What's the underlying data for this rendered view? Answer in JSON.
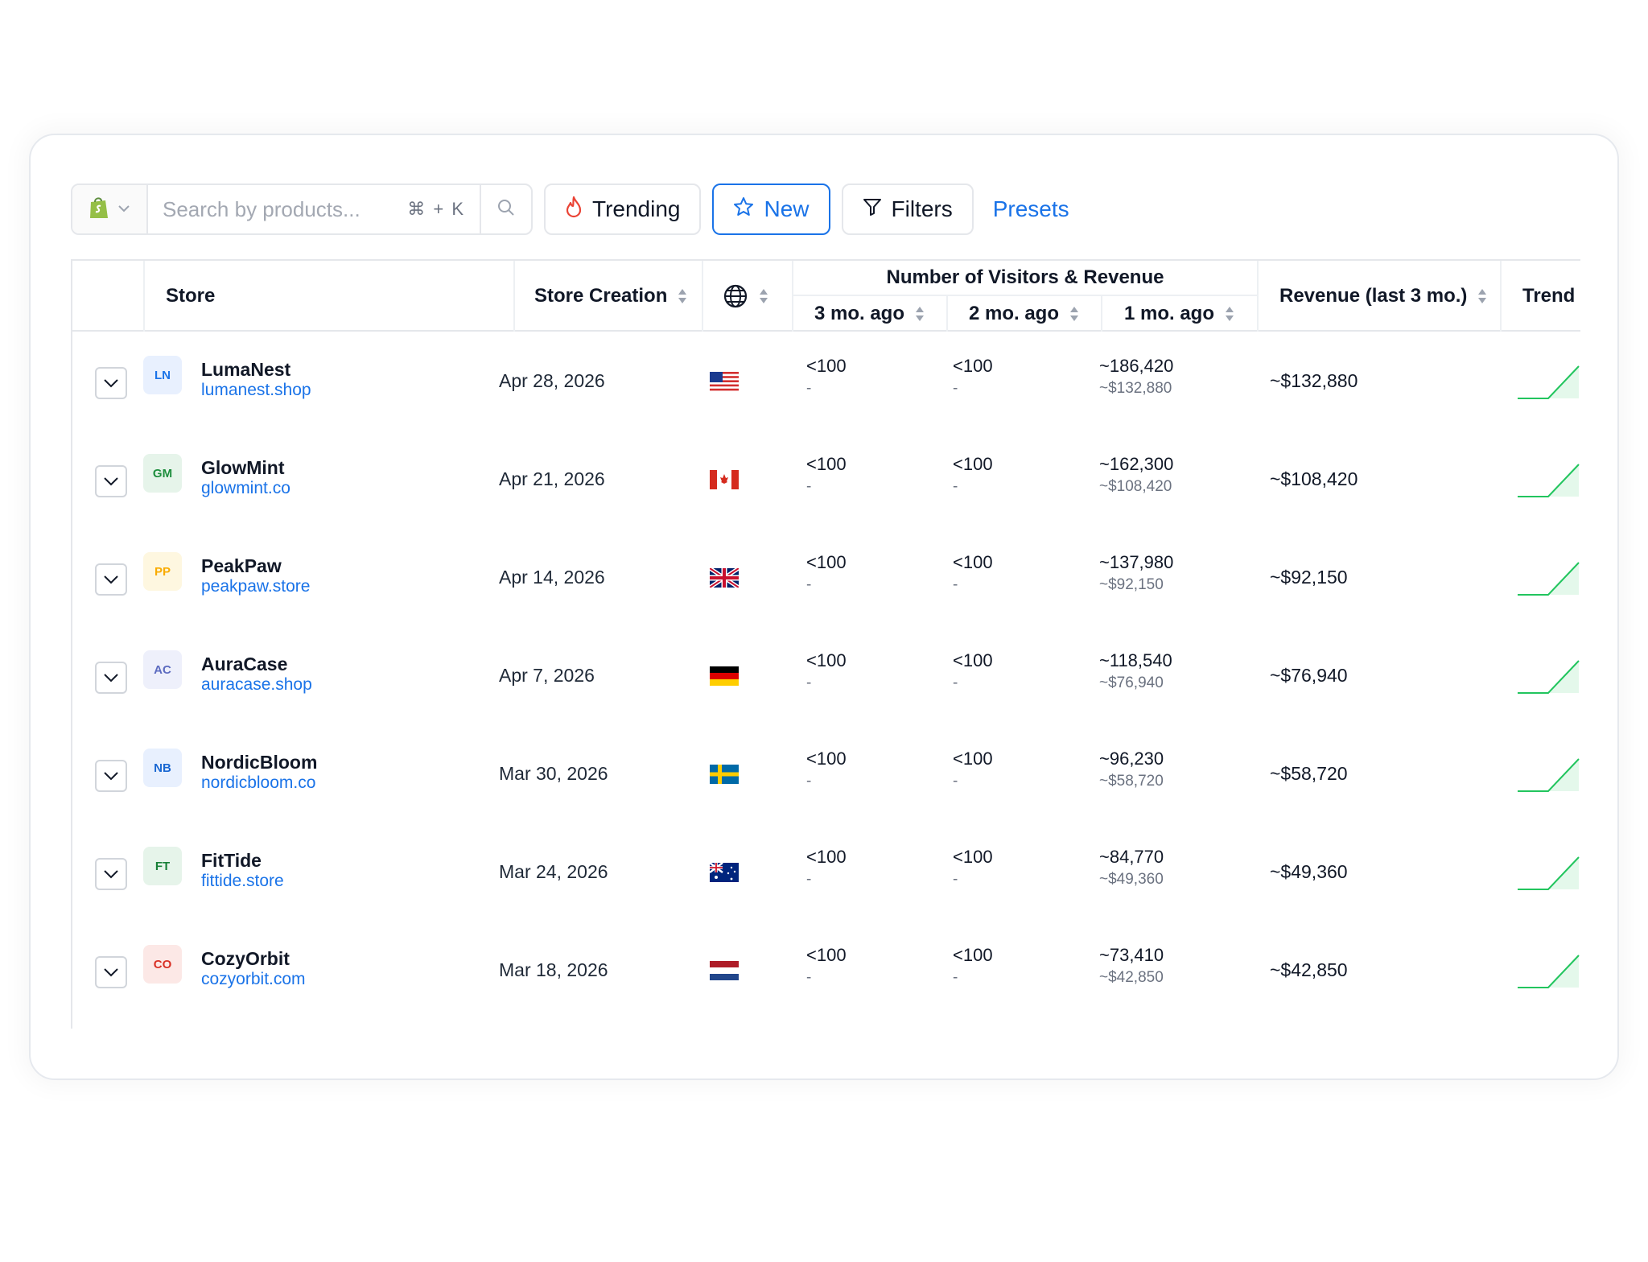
{
  "toolbar": {
    "platform_icon": "shopify-bag-icon",
    "search_placeholder": "Search by products...",
    "shortcut": "⌘ + K",
    "trending_label": "Trending",
    "new_label": "New",
    "filters_label": "Filters",
    "presets_label": "Presets",
    "accent_color": "#1a73e8"
  },
  "table": {
    "headers": {
      "store": "Store",
      "store_creation": "Store Creation",
      "country_icon": "globe-icon",
      "visitors_group": "Number of Visitors & Revenue",
      "m3": "3 mo. ago",
      "m2": "2 mo. ago",
      "m1": "1 mo. ago",
      "revenue": "Revenue (last 3 mo.)",
      "trend": "Trend"
    },
    "rows": [
      {
        "initials": "LN",
        "name": "LumaNest",
        "domain": "lumanest.shop",
        "created": "Apr 28, 2026",
        "country": "us",
        "m3_visitors": "<100",
        "m3_revenue": "-",
        "m2_visitors": "<100",
        "m2_revenue": "-",
        "m1_visitors": "~186,420",
        "m1_revenue": "~$132,880",
        "revenue": "~$132,880",
        "avatar_bg": "#e8f0fe",
        "avatar_fg": "#1a73e8"
      },
      {
        "initials": "GM",
        "name": "GlowMint",
        "domain": "glowmint.co",
        "created": "Apr 21, 2026",
        "country": "ca",
        "m3_visitors": "<100",
        "m3_revenue": "-",
        "m2_visitors": "<100",
        "m2_revenue": "-",
        "m1_visitors": "~162,300",
        "m1_revenue": "~$108,420",
        "revenue": "~$108,420",
        "avatar_bg": "#e6f4ea",
        "avatar_fg": "#1e8e3e"
      },
      {
        "initials": "PP",
        "name": "PeakPaw",
        "domain": "peakpaw.store",
        "created": "Apr 14, 2026",
        "country": "gb",
        "m3_visitors": "<100",
        "m3_revenue": "-",
        "m2_visitors": "<100",
        "m2_revenue": "-",
        "m1_visitors": "~137,980",
        "m1_revenue": "~$92,150",
        "revenue": "~$92,150",
        "avatar_bg": "#fef7e0",
        "avatar_fg": "#f9ab00"
      },
      {
        "initials": "AC",
        "name": "AuraCase",
        "domain": "auracase.shop",
        "created": "Apr 7, 2026",
        "country": "de",
        "m3_visitors": "<100",
        "m3_revenue": "-",
        "m2_visitors": "<100",
        "m2_revenue": "-",
        "m1_visitors": "~118,540",
        "m1_revenue": "~$76,940",
        "revenue": "~$76,940",
        "avatar_bg": "#eef0fb",
        "avatar_fg": "#5c6bc0"
      },
      {
        "initials": "NB",
        "name": "NordicBloom",
        "domain": "nordicbloom.co",
        "created": "Mar 30, 2026",
        "country": "se",
        "m3_visitors": "<100",
        "m3_revenue": "-",
        "m2_visitors": "<100",
        "m2_revenue": "-",
        "m1_visitors": "~96,230",
        "m1_revenue": "~$58,720",
        "revenue": "~$58,720",
        "avatar_bg": "#e8f0fe",
        "avatar_fg": "#1967d2"
      },
      {
        "initials": "FT",
        "name": "FitTide",
        "domain": "fittide.store",
        "created": "Mar 24, 2026",
        "country": "au",
        "m3_visitors": "<100",
        "m3_revenue": "-",
        "m2_visitors": "<100",
        "m2_revenue": "-",
        "m1_visitors": "~84,770",
        "m1_revenue": "~$49,360",
        "revenue": "~$49,360",
        "avatar_bg": "#e6f4ea",
        "avatar_fg": "#188038"
      },
      {
        "initials": "CO",
        "name": "CozyOrbit",
        "domain": "cozyorbit.com",
        "created": "Mar 18, 2026",
        "country": "nl",
        "m3_visitors": "<100",
        "m3_revenue": "-",
        "m2_visitors": "<100",
        "m2_revenue": "-",
        "m1_visitors": "~73,410",
        "m1_revenue": "~$42,850",
        "revenue": "~$42,850",
        "avatar_bg": "#fce8e6",
        "avatar_fg": "#d93025"
      }
    ],
    "trend_color": "#22c55e"
  }
}
